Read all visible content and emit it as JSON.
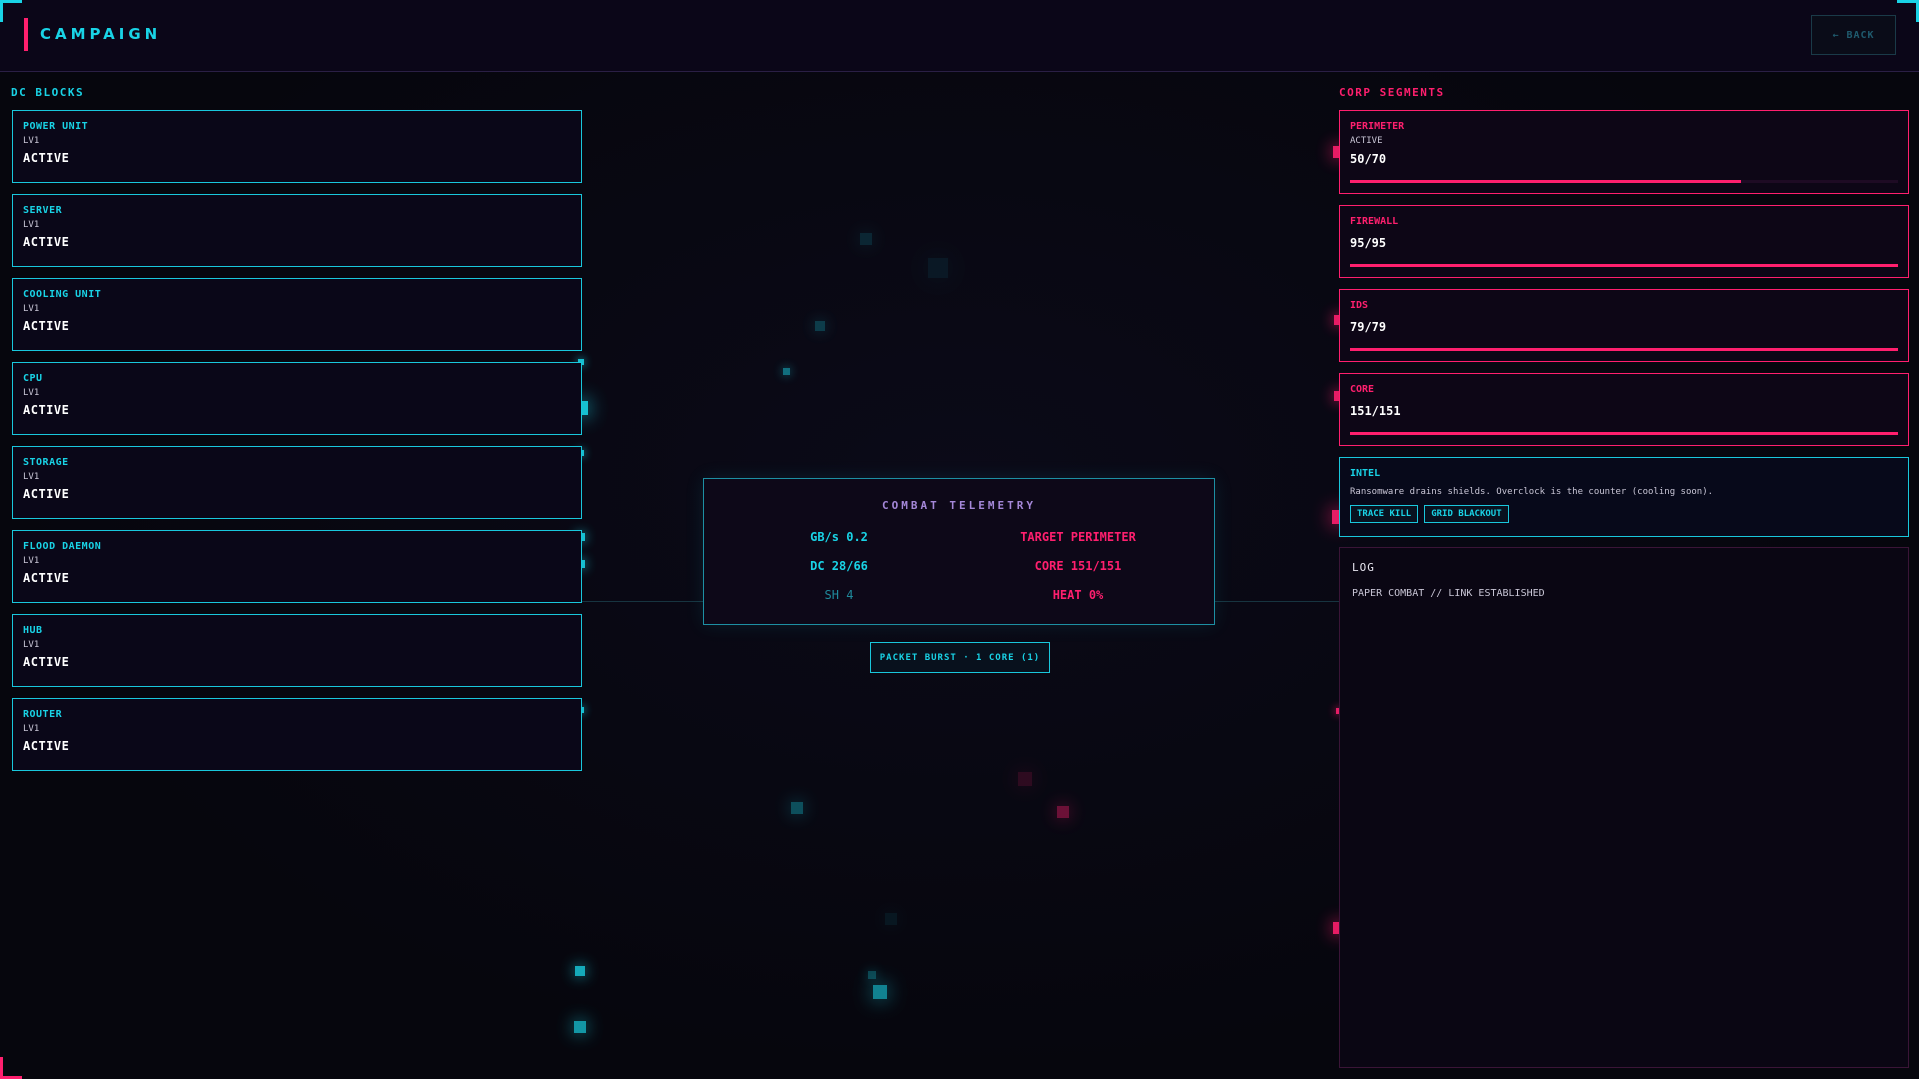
{
  "header": {
    "title": "CAMPAIGN",
    "back_label": "← BACK"
  },
  "dc_blocks": {
    "title": "DC BLOCKS",
    "items": [
      {
        "name": "POWER UNIT",
        "level": "LV1",
        "status": "ACTIVE"
      },
      {
        "name": "SERVER",
        "level": "LV1",
        "status": "ACTIVE"
      },
      {
        "name": "COOLING UNIT",
        "level": "LV1",
        "status": "ACTIVE"
      },
      {
        "name": "CPU",
        "level": "LV1",
        "status": "ACTIVE"
      },
      {
        "name": "STORAGE",
        "level": "LV1",
        "status": "ACTIVE"
      },
      {
        "name": "FLOOD DAEMON",
        "level": "LV1",
        "status": "ACTIVE"
      },
      {
        "name": "HUB",
        "level": "LV1",
        "status": "ACTIVE"
      },
      {
        "name": "ROUTER",
        "level": "LV1",
        "status": "ACTIVE"
      }
    ]
  },
  "corp_segments": {
    "title": "CORP SEGMENTS",
    "items": [
      {
        "name": "PERIMETER",
        "sub": "ACTIVE",
        "hp": "50/70",
        "fill": 0.714
      },
      {
        "name": "FIREWALL",
        "sub": "",
        "hp": "95/95",
        "fill": 1.0
      },
      {
        "name": "IDS",
        "sub": "",
        "hp": "79/79",
        "fill": 1.0
      },
      {
        "name": "CORE",
        "sub": "",
        "hp": "151/151",
        "fill": 1.0
      }
    ]
  },
  "intel": {
    "title": "INTEL",
    "text": "Ransomware drains shields. Overclock is the counter (cooling soon).",
    "buttons": [
      "TRACE KILL",
      "GRID BLACKOUT"
    ]
  },
  "log": {
    "title": "LOG",
    "lines": [
      "PAPER COMBAT // LINK ESTABLISHED"
    ]
  },
  "telemetry": {
    "title": "COMBAT TELEMETRY",
    "gbs": "GB/s 0.2",
    "target": "TARGET PERIMETER",
    "dc": "DC 28/66",
    "core": "CORE 151/151",
    "sh": "SH 4",
    "heat": "HEAT 0%"
  },
  "actions": {
    "packet_burst": "PACKET BURST · 1 CORE (1)"
  },
  "colors": {
    "cyan": "#19d3e6",
    "pink": "#ff1f6e",
    "violet": "#a487d8",
    "background": "#07060f"
  }
}
